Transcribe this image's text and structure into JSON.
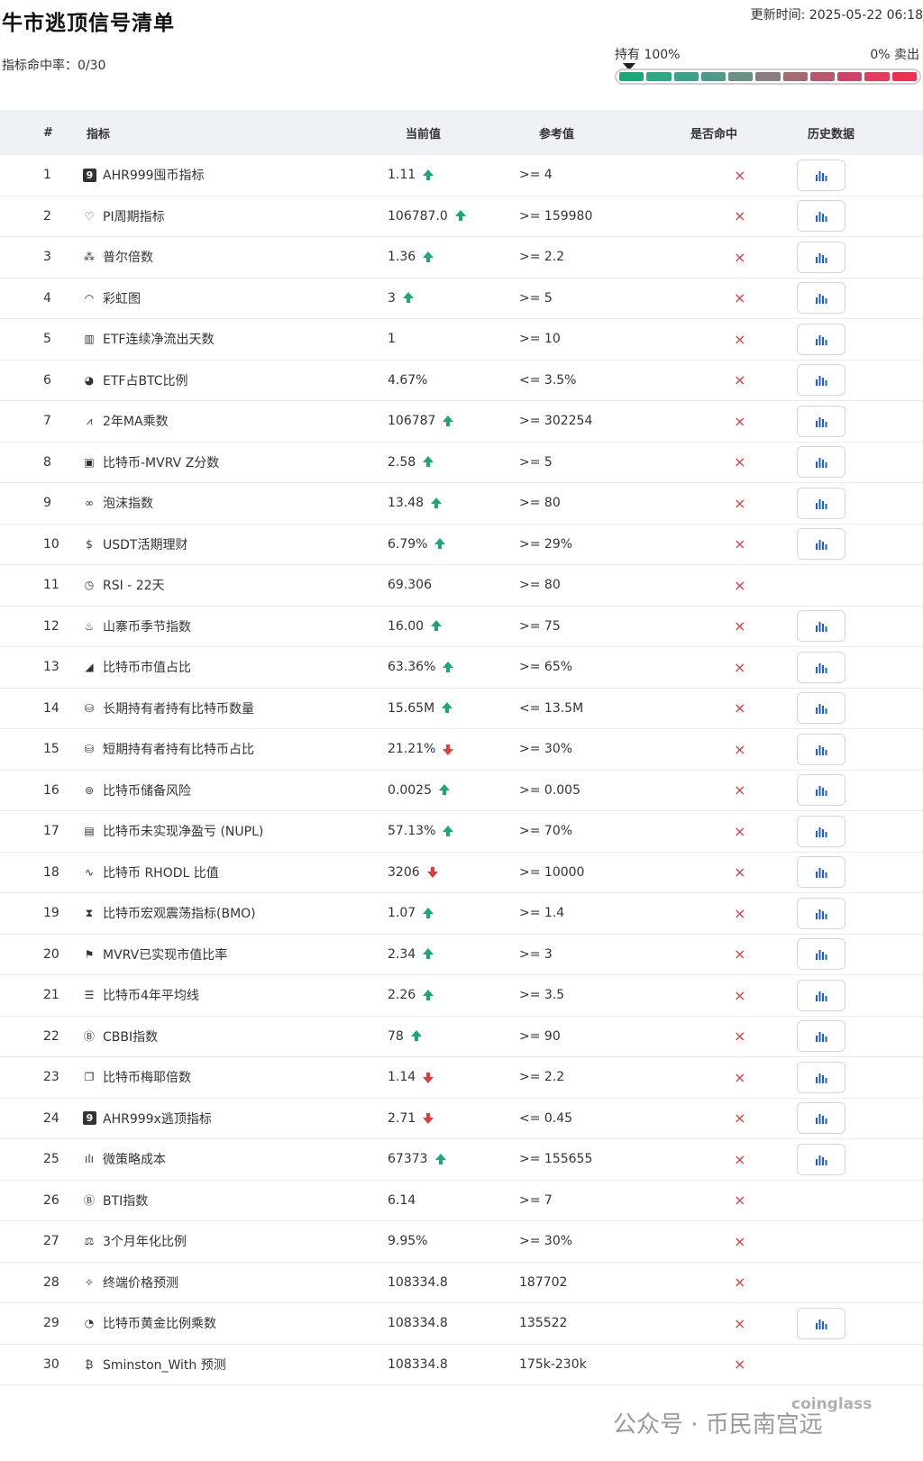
{
  "header": {
    "title": "牛市逃顶信号清单",
    "updated": "更新时间: 2025-05-22 06:18",
    "hit_rate": "指标命中率：0/30"
  },
  "gauge": {
    "left_label": "持有 100%",
    "right_label": "0% 卖出",
    "value_fraction": 0.0,
    "colors": [
      "#1aa87a",
      "#2aa984",
      "#3aa28a",
      "#4d9a88",
      "#6b8f84",
      "#8a7e7e",
      "#a36a76",
      "#b9566d",
      "#cf4466",
      "#e23b5c",
      "#ec3150"
    ]
  },
  "columns": {
    "num": "#",
    "name": "指标",
    "current": "当前值",
    "reference": "参考值",
    "hit": "是否命中",
    "history": "历史数据"
  },
  "rows": [
    {
      "num": "1",
      "icon": "ahr-box-icon",
      "glyph": "9",
      "box": true,
      "name": "AHR999囤币指标",
      "current": "1.11",
      "trend": "up",
      "reference": ">= 4",
      "hit": "×",
      "history": true
    },
    {
      "num": "2",
      "icon": "pi-cycle-icon",
      "glyph": "♡",
      "box": false,
      "name": "PI周期指标",
      "current": "106787.0",
      "trend": "up",
      "reference": ">= 159980",
      "hit": "×",
      "history": true
    },
    {
      "num": "3",
      "icon": "puell-icon",
      "glyph": "⁂",
      "box": false,
      "name": "普尔倍数",
      "current": "1.36",
      "trend": "up",
      "reference": ">= 2.2",
      "hit": "×",
      "history": true
    },
    {
      "num": "4",
      "icon": "rainbow-icon",
      "glyph": "◠",
      "box": false,
      "name": "彩虹图",
      "current": "3",
      "trend": "up",
      "reference": ">= 5",
      "hit": "×",
      "history": true
    },
    {
      "num": "5",
      "icon": "bar-chart-icon",
      "glyph": "▥",
      "box": false,
      "name": "ETF连续净流出天数",
      "current": "1",
      "trend": "",
      "reference": ">= 10",
      "hit": "×",
      "history": true
    },
    {
      "num": "6",
      "icon": "pie-chart-icon",
      "glyph": "◕",
      "box": false,
      "name": "ETF占BTC比例",
      "current": "4.67%",
      "trend": "",
      "reference": "<= 3.5%",
      "hit": "×",
      "history": true
    },
    {
      "num": "7",
      "icon": "line-chart-icon",
      "glyph": "⩘",
      "box": false,
      "name": "2年MA乘数",
      "current": "106787",
      "trend": "up",
      "reference": ">= 302254",
      "hit": "×",
      "history": true
    },
    {
      "num": "8",
      "icon": "clipboard-icon",
      "glyph": "▣",
      "box": false,
      "name": "比特币-MVRV Z分数",
      "current": "2.58",
      "trend": "up",
      "reference": ">= 5",
      "hit": "×",
      "history": true
    },
    {
      "num": "9",
      "icon": "bubbles-icon",
      "glyph": "∞",
      "box": false,
      "name": "泡沫指数",
      "current": "13.48",
      "trend": "up",
      "reference": ">= 80",
      "hit": "×",
      "history": true
    },
    {
      "num": "10",
      "icon": "dollar-icon",
      "glyph": "$",
      "box": false,
      "name": "USDT活期理财",
      "current": "6.79%",
      "trend": "up",
      "reference": ">= 29%",
      "hit": "×",
      "history": true
    },
    {
      "num": "11",
      "icon": "clock-icon",
      "glyph": "◷",
      "box": false,
      "name": "RSI - 22天",
      "current": "69.306",
      "trend": "",
      "reference": ">= 80",
      "hit": "×",
      "history": false
    },
    {
      "num": "12",
      "icon": "flame-icon",
      "glyph": "♨",
      "box": false,
      "name": "山寨币季节指数",
      "current": "16.00",
      "trend": "up",
      "reference": ">= 75",
      "hit": "×",
      "history": true
    },
    {
      "num": "13",
      "icon": "signal-icon",
      "glyph": "◢",
      "box": false,
      "name": "比特币市值占比",
      "current": "63.36%",
      "trend": "up",
      "reference": ">= 65%",
      "hit": "×",
      "history": true
    },
    {
      "num": "14",
      "icon": "database-icon",
      "glyph": "⛁",
      "box": false,
      "name": "长期持有者持有比特币数量",
      "current": "15.65M",
      "trend": "up",
      "reference": "<= 13.5M",
      "hit": "×",
      "history": true
    },
    {
      "num": "15",
      "icon": "database-icon",
      "glyph": "⛁",
      "box": false,
      "name": "短期持有者持有比特币占比",
      "current": "21.21%",
      "trend": "down",
      "reference": ">= 30%",
      "hit": "×",
      "history": true
    },
    {
      "num": "16",
      "icon": "coins-icon",
      "glyph": "⊚",
      "box": false,
      "name": "比特币储备风险",
      "current": "0.0025",
      "trend": "up",
      "reference": ">= 0.005",
      "hit": "×",
      "history": true
    },
    {
      "num": "17",
      "icon": "receipt-icon",
      "glyph": "▤",
      "box": false,
      "name": "比特币未实现净盈亏 (NUPL)",
      "current": "57.13%",
      "trend": "up",
      "reference": ">= 70%",
      "hit": "×",
      "history": true
    },
    {
      "num": "18",
      "icon": "pulse-icon",
      "glyph": "∿",
      "box": false,
      "name": "比特币 RHODL 比值",
      "current": "3206",
      "trend": "down",
      "reference": ">= 10000",
      "hit": "×",
      "history": true
    },
    {
      "num": "19",
      "icon": "hourglass-icon",
      "glyph": "⧗",
      "box": false,
      "name": "比特币宏观震荡指标(BMO)",
      "current": "1.07",
      "trend": "up",
      "reference": ">= 1.4",
      "hit": "×",
      "history": true
    },
    {
      "num": "20",
      "icon": "flag-icon",
      "glyph": "⚑",
      "box": false,
      "name": "MVRV已实现市值比率",
      "current": "2.34",
      "trend": "up",
      "reference": ">= 3",
      "hit": "×",
      "history": true
    },
    {
      "num": "21",
      "icon": "list-icon",
      "glyph": "☰",
      "box": false,
      "name": "比特币4年平均线",
      "current": "2.26",
      "trend": "up",
      "reference": ">= 3.5",
      "hit": "×",
      "history": true
    },
    {
      "num": "22",
      "icon": "b-circle-icon",
      "glyph": "Ⓑ",
      "box": false,
      "name": "CBBI指数",
      "current": "78",
      "trend": "up",
      "reference": ">= 90",
      "hit": "×",
      "history": true
    },
    {
      "num": "23",
      "icon": "copy-icon",
      "glyph": "❐",
      "box": false,
      "name": "比特币梅耶倍数",
      "current": "1.14",
      "trend": "down",
      "reference": ">= 2.2",
      "hit": "×",
      "history": true
    },
    {
      "num": "24",
      "icon": "ahr-box-icon",
      "glyph": "9",
      "box": true,
      "name": "AHR999x逃顶指标",
      "current": "2.71",
      "trend": "down",
      "reference": "<= 0.45",
      "hit": "×",
      "history": true
    },
    {
      "num": "25",
      "icon": "bar-chart-icon",
      "glyph": "ılı",
      "box": false,
      "name": "微策略成本",
      "current": "67373",
      "trend": "up",
      "reference": ">= 155655",
      "hit": "×",
      "history": true
    },
    {
      "num": "26",
      "icon": "b-circle-icon",
      "glyph": "Ⓑ",
      "box": false,
      "name": "BTI指数",
      "current": "6.14",
      "trend": "",
      "reference": ">= 7",
      "hit": "×",
      "history": false
    },
    {
      "num": "27",
      "icon": "scale-icon",
      "glyph": "⚖",
      "box": false,
      "name": "3个月年化比例",
      "current": "9.95%",
      "trend": "",
      "reference": ">= 30%",
      "hit": "×",
      "history": false
    },
    {
      "num": "28",
      "icon": "sparkle-icon",
      "glyph": "✧",
      "box": false,
      "name": "终端价格预测",
      "current": "108334.8",
      "trend": "",
      "reference": "187702",
      "hit": "×",
      "history": false
    },
    {
      "num": "29",
      "icon": "gauge-icon",
      "glyph": "◔",
      "box": false,
      "name": "比特币黄金比例乘数",
      "current": "108334.8",
      "trend": "",
      "reference": "135522",
      "hit": "×",
      "history": true
    },
    {
      "num": "30",
      "icon": "bitcoin-icon",
      "glyph": "₿",
      "box": false,
      "name": "Sminston_With 预测",
      "current": "108334.8",
      "trend": "",
      "reference": "175k-230k",
      "hit": "×",
      "history": false
    }
  ],
  "watermark": {
    "text": "公众号 · 币民南宫远",
    "logo": "coinglass",
    "handle": "@南宫远"
  }
}
